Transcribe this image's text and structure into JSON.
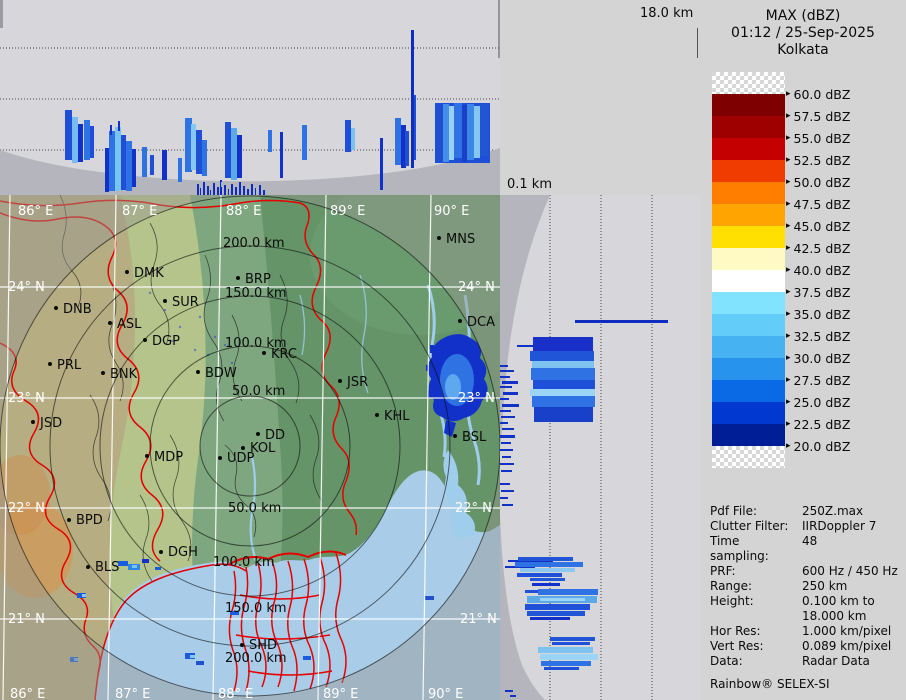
{
  "title": {
    "product": "MAX (dBZ)",
    "datetime": "01:12 / 25-Sep-2025",
    "site": "Kolkata"
  },
  "axes": {
    "height_max": "18.0 km",
    "height_min": "0.1 km"
  },
  "legend": {
    "arrow": "▸",
    "labels": [
      "60.0 dBZ",
      "57.5 dBZ",
      "55.0 dBZ",
      "52.5 dBZ",
      "50.0 dBZ",
      "47.5 dBZ",
      "45.0 dBZ",
      "42.5 dBZ",
      "40.0 dBZ",
      "37.5 dBZ",
      "35.0 dBZ",
      "32.5 dBZ",
      "30.0 dBZ",
      "27.5 dBZ",
      "25.0 dBZ",
      "22.5 dBZ",
      "20.0 dBZ"
    ],
    "band_colors": [
      "#7e0000",
      "#9e0000",
      "#c40000",
      "#f03c00",
      "#ff7e00",
      "#ffa400",
      "#ffe000",
      "#fff9c4",
      "#ffffff",
      "#82e3ff",
      "#64ccf8",
      "#46b2f2",
      "#2893ec",
      "#0a6ae6",
      "#0038d0",
      "#001e96"
    ]
  },
  "map": {
    "lon_top": [
      "86° E",
      "87° E",
      "88° E",
      "89° E",
      "90° E"
    ],
    "lon_bottom": [
      "86° E",
      "87° E",
      "88° E",
      "89° E",
      "90° E"
    ],
    "lat_left": [
      "24° N",
      "23° N",
      "22° N",
      "21° N"
    ],
    "lat_right": [
      "24° N",
      "23° N",
      "22° N",
      "21° N"
    ],
    "rings": [
      "200.0 km",
      "150.0 km",
      "100.0 km",
      "50.0 km",
      "50.0 km",
      "100.0 km",
      "150.0 km",
      "200.0 km"
    ],
    "cities": [
      "DMK",
      "BRP",
      "SUR",
      "DNB",
      "ASL",
      "DGP",
      "PRL",
      "BNK",
      "KRC",
      "BDW",
      "JSR",
      "JSD",
      "KHL",
      "DD",
      "KOL",
      "UDP",
      "MDP",
      "BPD",
      "DGH",
      "BLS",
      "SHD",
      "MNS",
      "DCA",
      "BSL"
    ]
  },
  "info": {
    "rows": [
      {
        "label": "Pdf File:",
        "value": "250Z.max"
      },
      {
        "label": "Clutter Filter:",
        "value": "IIRDoppler 7"
      },
      {
        "label": "Time sampling:",
        "value": "48"
      },
      {
        "label": "PRF:",
        "value": "600 Hz / 450 Hz"
      },
      {
        "label": "Range:",
        "value": "250 km"
      },
      {
        "label": "Height:",
        "value": "0.100 km to"
      },
      {
        "label": "",
        "value": "18.000 km"
      },
      {
        "label": "Hor Res:",
        "value": "1.000 km/pixel"
      },
      {
        "label": "Vert Res:",
        "value": "0.089 km/pixel"
      },
      {
        "label": "Data:",
        "value": "Radar Data"
      }
    ],
    "brand": "Rainbow® SELEX-SI"
  },
  "colors": {
    "panel_bg": "#d7d7db",
    "blind_wedge": "#b5b5bd",
    "land_green": "#7fa77f",
    "sea_blue": "#a9cde9",
    "border_red": "#e60000",
    "grid_white": "#ffffff",
    "echo_dark_blue": "#1131c8",
    "echo_mid_blue": "#2e72e4",
    "echo_light_blue": "#9ad4f6"
  }
}
